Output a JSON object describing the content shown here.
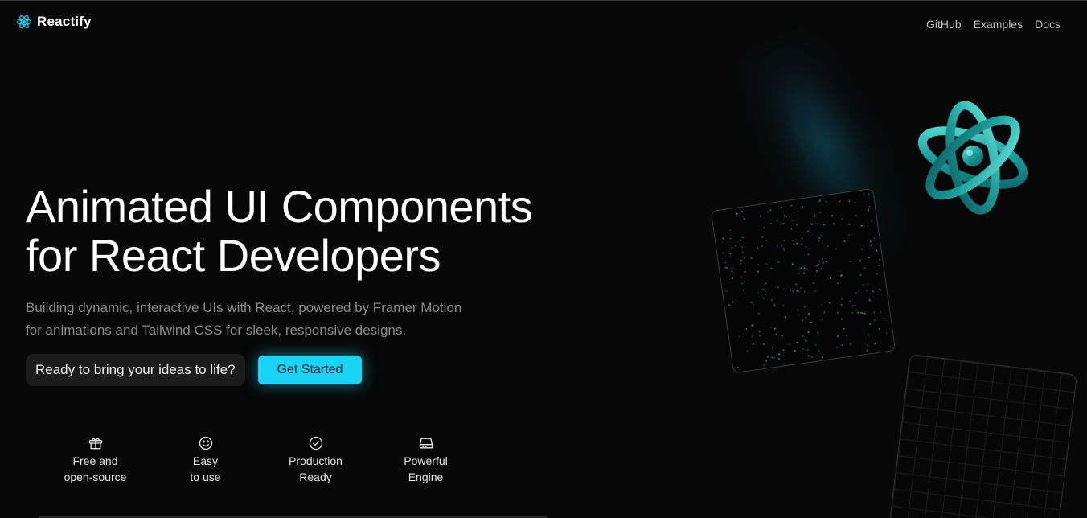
{
  "brand": {
    "name": "Reactify",
    "logo_icon": "react-atom-icon"
  },
  "nav": {
    "items": [
      "GitHub",
      "Examples",
      "Docs"
    ]
  },
  "hero": {
    "title_lines": [
      "Animated UI Components",
      "for React Developers"
    ],
    "subtitle_lines": [
      "Building dynamic, interactive UIs with React, powered by Framer Motion",
      "for animations and Tailwind CSS for sleek, responsive designs."
    ],
    "prompt_text": "Ready to bring your ideas to life?",
    "cta_label": "Get Started"
  },
  "features": [
    {
      "icon": "gift-icon",
      "line1": "Free and",
      "line2": "open-source"
    },
    {
      "icon": "smiley-icon",
      "line1": "Easy",
      "line2": "to use"
    },
    {
      "icon": "check-circle-icon",
      "line1": "Production",
      "line2": "Ready"
    },
    {
      "icon": "hard-drive-icon",
      "line1": "Powerful",
      "line2": "Engine"
    }
  ],
  "colors": {
    "background": "#080808",
    "accent": "#19d4f3",
    "muted_text": "#8a8a8a",
    "atom_teal": "#1fa6a6"
  }
}
